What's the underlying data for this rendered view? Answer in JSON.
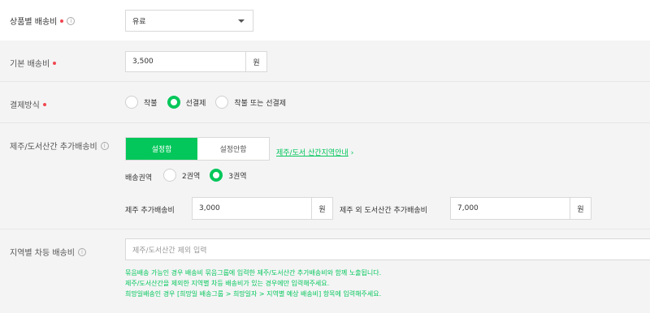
{
  "per_product_fee": {
    "label": "상품별 배송비",
    "selected": "유료"
  },
  "base_fee": {
    "label": "기본 배송비",
    "value": "3,500",
    "unit": "원"
  },
  "payment": {
    "label": "결제방식",
    "options": [
      "착불",
      "선결제",
      "착불 또는 선결제"
    ],
    "selected_index": 1
  },
  "jeju": {
    "label": "제주/도서산간 추가배송비",
    "toggle": [
      "설정함",
      "설정안함"
    ],
    "link": "제주/도서 산간지역안내",
    "region_label": "배송권역",
    "region_options": [
      "2권역",
      "3권역"
    ],
    "region_selected_index": 1,
    "jeju_fee_label": "제주 추가배송비",
    "jeju_fee_value": "3,000",
    "jeju_fee_unit": "원",
    "other_fee_label": "제주 외 도서산간 추가배송비",
    "other_fee_value": "7,000",
    "other_fee_unit": "원"
  },
  "regional": {
    "label": "지역별 차등 배송비",
    "placeholder": "제주/도서산간 제외 입력",
    "notices": [
      "묶음배송 가능인 경우 배송비 묶음그룹에 입력한 제주/도서산간 추가배송비와 함께 노출됩니다.",
      "제주/도서산간을 제외한 지역별 차등 배송비가 있는 경우에만 입력해주세요.",
      "희망일배송인 경우 [희망일 배송그룹 > 희망일자 > 지역별 예상 배송비] 항목에 입력해주세요."
    ]
  },
  "colors": {
    "accent": "#03c75a",
    "required_dot": "#f0464f"
  }
}
